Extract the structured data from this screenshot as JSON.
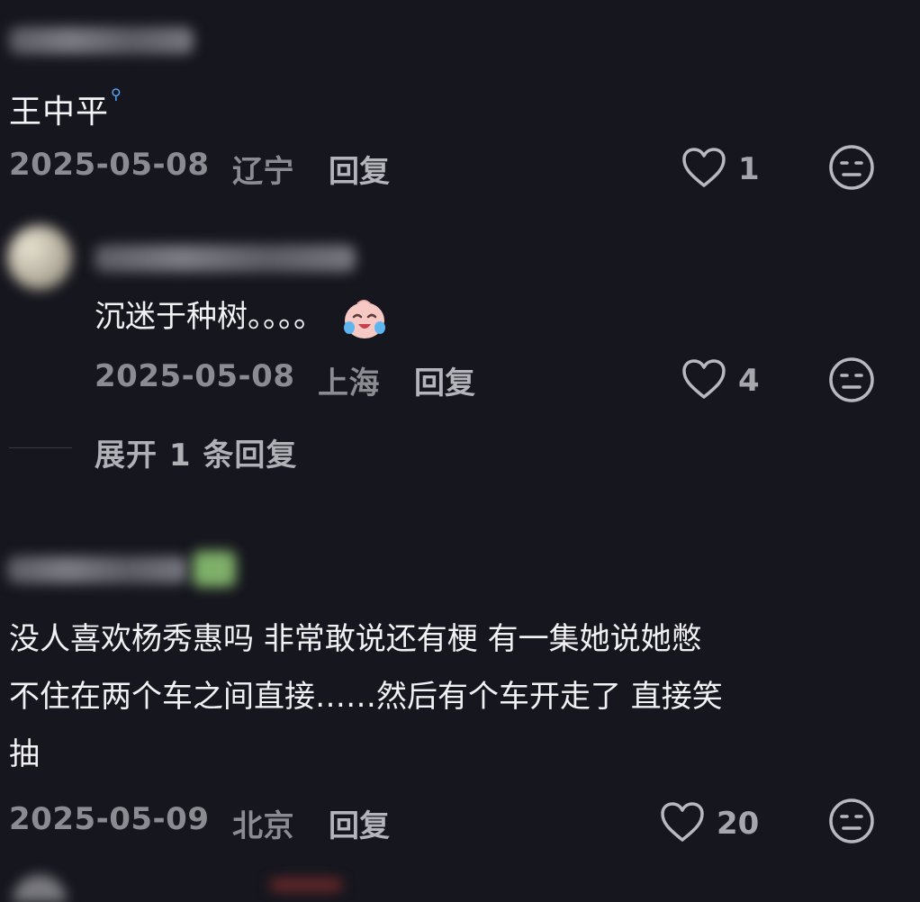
{
  "comments": [
    {
      "author_label": "王中平",
      "date": "2025-05-08",
      "location": "辽宁",
      "reply_label": "回复",
      "likes": "1"
    },
    {
      "text": "沉迷于种树。。。。",
      "date": "2025-05-08",
      "location": "上海",
      "reply_label": "回复",
      "likes": "4",
      "expand_label": "展开 1 条回复"
    },
    {
      "text_lines": [
        "没人喜欢杨秀惠吗 非常敢说还有梗  有一集她说她憋",
        "不住在两个车之间直接……然后有个车开走了 直接笑",
        "抽"
      ],
      "date": "2025-05-09",
      "location": "北京",
      "reply_label": "回复",
      "likes": "20"
    }
  ],
  "colors": {
    "background": "#16161e",
    "meta_text": "#8b8b92",
    "search_accent": "#5aa9ff"
  }
}
